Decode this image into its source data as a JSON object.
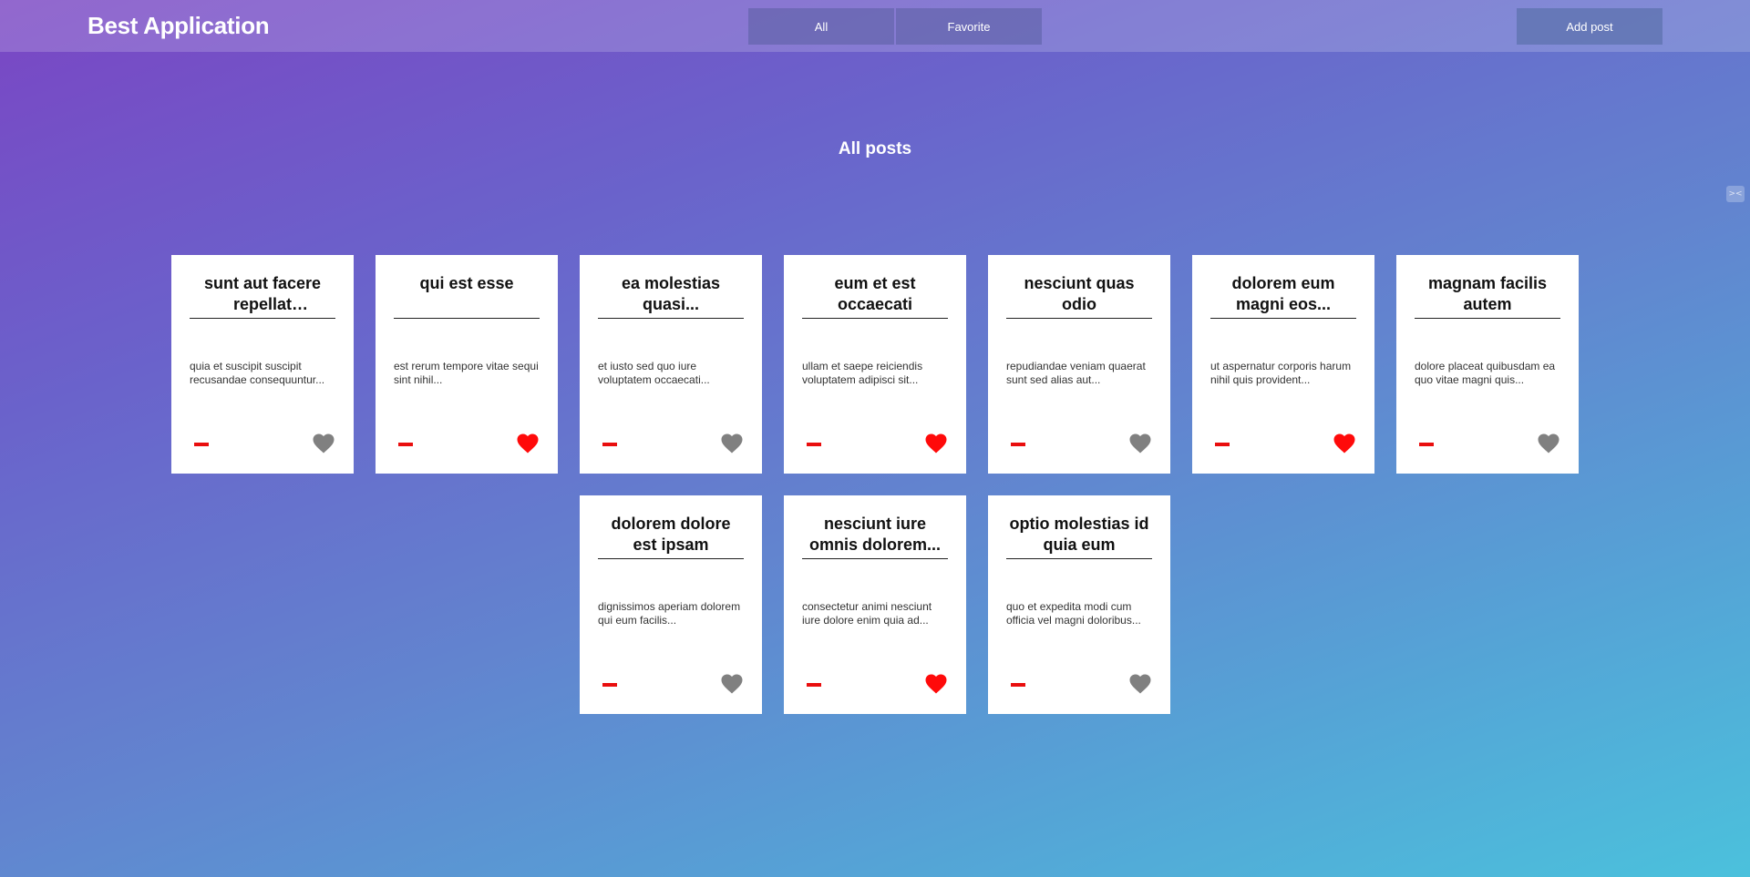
{
  "app": {
    "title": "Best Application"
  },
  "nav": {
    "all_label": "All",
    "favorite_label": "Favorite",
    "add_label": "Add post"
  },
  "page": {
    "title": "All posts"
  },
  "side_widget": {
    "glyph": "><"
  },
  "colors": {
    "heart_active": "#ff0a0a",
    "heart_inactive": "#808080",
    "remove": "#e90e0e"
  },
  "posts": [
    {
      "title": "sunt aut facere repellat providen...",
      "body": "quia et suscipit suscipit recusandae consequuntur...",
      "favorite": false
    },
    {
      "title": "qui est esse",
      "body": "est rerum tempore vitae sequi sint nihil...",
      "favorite": true
    },
    {
      "title": "ea molestias quasi...",
      "body": "et iusto sed quo iure voluptatem occaecati...",
      "favorite": false
    },
    {
      "title": "eum et est occaecati",
      "body": "ullam et saepe reiciendis voluptatem adipisci sit...",
      "favorite": true
    },
    {
      "title": "nesciunt quas odio",
      "body": "repudiandae veniam quaerat sunt sed alias aut...",
      "favorite": false
    },
    {
      "title": "dolorem eum magni eos...",
      "body": "ut aspernatur corporis harum nihil quis provident...",
      "favorite": true
    },
    {
      "title": "magnam facilis autem",
      "body": "dolore placeat quibusdam ea quo vitae magni quis...",
      "favorite": false
    },
    {
      "title": "dolorem dolore est ipsam",
      "body": "dignissimos aperiam dolorem qui eum facilis...",
      "favorite": false
    },
    {
      "title": "nesciunt iure omnis dolorem...",
      "body": "consectetur animi nesciunt iure dolore enim quia ad...",
      "favorite": true
    },
    {
      "title": "optio molestias id quia eum",
      "body": "quo et expedita modi cum officia vel magni doloribus...",
      "favorite": false
    }
  ]
}
